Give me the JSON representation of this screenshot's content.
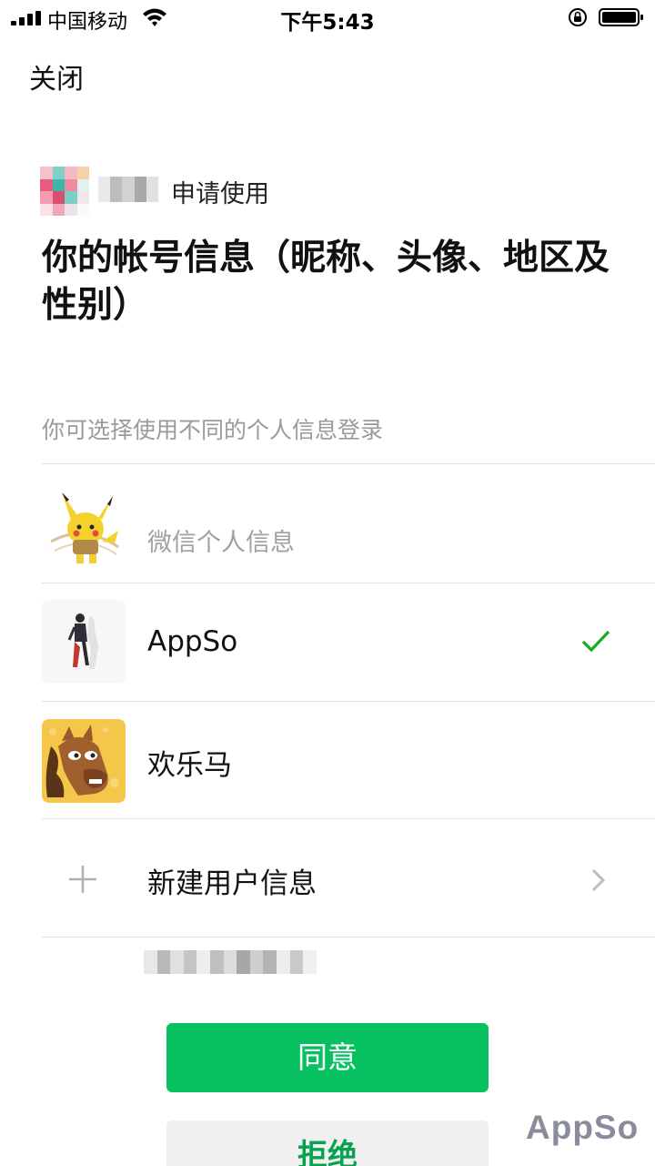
{
  "status_bar": {
    "carrier": "中国移动",
    "time": "下午5:43",
    "icons": [
      "signal-icon",
      "wifi-icon",
      "orientation-lock-icon",
      "battery-icon"
    ]
  },
  "header": {
    "close_label": "关闭"
  },
  "app": {
    "request_text": "申请使用",
    "headline": "你的帐号信息（昵称、头像、地区及性别）"
  },
  "identity": {
    "hint": "你可选择使用不同的个人信息登录",
    "options": [
      {
        "label": "",
        "sublabel": "微信个人信息",
        "avatar": "pikachu-avatar",
        "selected": false
      },
      {
        "label": "AppSo",
        "avatar": "runner-avatar",
        "selected": true
      },
      {
        "label": "欢乐马",
        "avatar": "horse-avatar",
        "selected": false
      }
    ],
    "new_label": "新建用户信息"
  },
  "actions": {
    "agree_label": "同意",
    "reject_label": "拒绝"
  },
  "watermark": "AppSo",
  "colors": {
    "primary_green": "#07c160",
    "check_green": "#1aad19",
    "hint_gray": "#9a9a9a"
  }
}
